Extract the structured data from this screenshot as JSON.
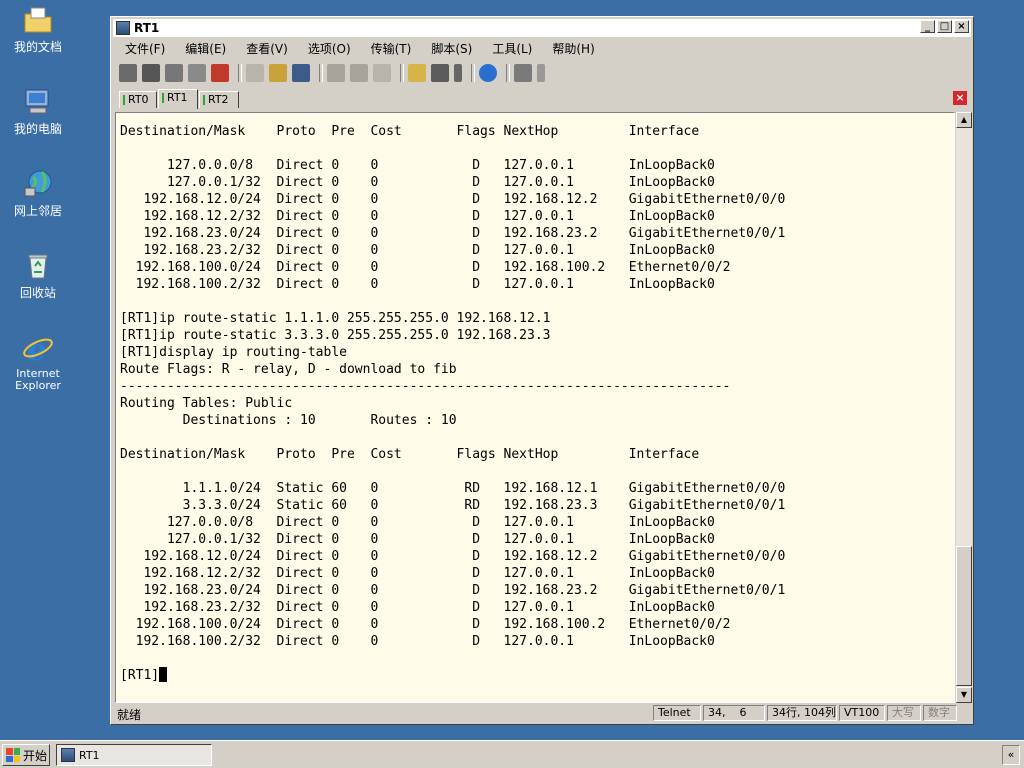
{
  "desktop": {
    "icons": [
      {
        "label": "我的文档"
      },
      {
        "label": "我的电脑"
      },
      {
        "label": "网上邻居"
      },
      {
        "label": "回收站"
      },
      {
        "label": "Internet\nExplorer"
      }
    ]
  },
  "window": {
    "title": "RT1",
    "min_glyph": "_",
    "max_glyph": "□",
    "close_glyph": "×"
  },
  "menu": [
    "文件(F)",
    "编辑(E)",
    "查看(V)",
    "选项(O)",
    "传输(T)",
    "脚本(S)",
    "工具(L)",
    "帮助(H)"
  ],
  "toolbar_icons": [
    "connect-icon",
    "quick-connect-icon",
    "connect-tab-icon",
    "reconnect-icon",
    "disconnect-icon",
    "copy-icon",
    "paste-icon",
    "find-icon",
    "print-icon",
    "print-setup-icon",
    "print-screen-icon",
    "session-options-icon",
    "global-options-icon",
    "keymap-icon",
    "help-icon",
    "extra-icon"
  ],
  "tabs": [
    {
      "label": "RT0",
      "active": false
    },
    {
      "label": "RT1",
      "active": true
    },
    {
      "label": "RT2",
      "active": false
    }
  ],
  "terminal": {
    "lines": [
      "Destination/Mask    Proto  Pre  Cost       Flags NextHop         Interface",
      "",
      "      127.0.0.0/8   Direct 0    0            D   127.0.0.1       InLoopBack0",
      "      127.0.0.1/32  Direct 0    0            D   127.0.0.1       InLoopBack0",
      "   192.168.12.0/24  Direct 0    0            D   192.168.12.2    GigabitEthernet0/0/0",
      "   192.168.12.2/32  Direct 0    0            D   127.0.0.1       InLoopBack0",
      "   192.168.23.0/24  Direct 0    0            D   192.168.23.2    GigabitEthernet0/0/1",
      "   192.168.23.2/32  Direct 0    0            D   127.0.0.1       InLoopBack0",
      "  192.168.100.0/24  Direct 0    0            D   192.168.100.2   Ethernet0/0/2",
      "  192.168.100.2/32  Direct 0    0            D   127.0.0.1       InLoopBack0",
      "",
      "[RT1]ip route-static 1.1.1.0 255.255.255.0 192.168.12.1",
      "[RT1]ip route-static 3.3.3.0 255.255.255.0 192.168.23.3",
      "[RT1]display ip routing-table",
      "Route Flags: R - relay, D - download to fib",
      "------------------------------------------------------------------------------",
      "Routing Tables: Public",
      "        Destinations : 10       Routes : 10",
      "",
      "Destination/Mask    Proto  Pre  Cost       Flags NextHop         Interface",
      "",
      "        1.1.1.0/24  Static 60   0           RD   192.168.12.1    GigabitEthernet0/0/0",
      "        3.3.3.0/24  Static 60   0           RD   192.168.23.3    GigabitEthernet0/0/1",
      "      127.0.0.0/8   Direct 0    0            D   127.0.0.1       InLoopBack0",
      "      127.0.0.1/32  Direct 0    0            D   127.0.0.1       InLoopBack0",
      "   192.168.12.0/24  Direct 0    0            D   192.168.12.2    GigabitEthernet0/0/0",
      "   192.168.12.2/32  Direct 0    0            D   127.0.0.1       InLoopBack0",
      "   192.168.23.0/24  Direct 0    0            D   192.168.23.2    GigabitEthernet0/0/1",
      "   192.168.23.2/32  Direct 0    0            D   127.0.0.1       InLoopBack0",
      "  192.168.100.0/24  Direct 0    0            D   192.168.100.2   Ethernet0/0/2",
      "  192.168.100.2/32  Direct 0    0            D   127.0.0.1       InLoopBack0",
      "",
      "[RT1]"
    ]
  },
  "status": {
    "ready": "就绪",
    "protocol": "Telnet",
    "position": "34,    6",
    "rows_cols": "34行, 104列",
    "terminal_type": "VT100",
    "caps": "大写",
    "num": "数字"
  },
  "taskbar": {
    "start_label": "开始",
    "task_label": "RT1",
    "tray_glyph": "«"
  },
  "colors": {
    "desktop": "#3a6ea5",
    "terminal_bg": "#fefbe8",
    "tab_indicator": "#2fa52f",
    "close_tab": "#d9262d"
  }
}
